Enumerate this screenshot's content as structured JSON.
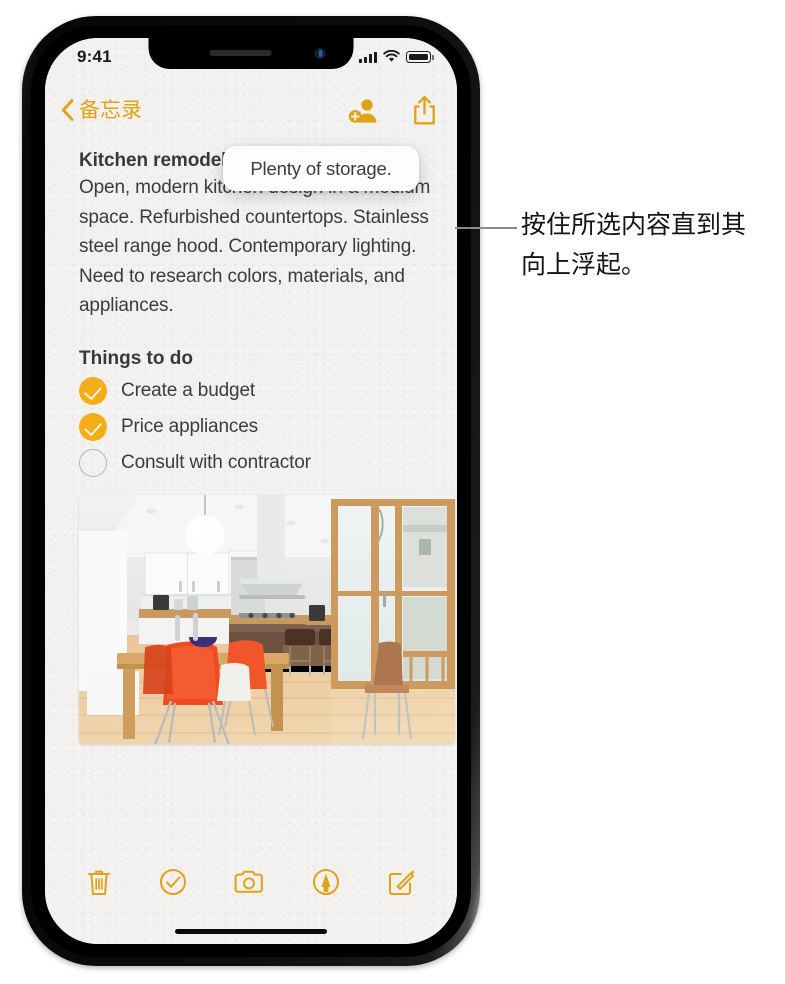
{
  "status_bar": {
    "time": "9:41",
    "cellular_icon": "signal-bars-icon",
    "wifi_icon": "wifi-icon",
    "battery_icon": "battery-full-icon"
  },
  "nav_bar": {
    "back_label": "备忘录",
    "back_icon": "chevron-left-icon",
    "collaborate_icon": "add-person-icon",
    "share_icon": "share-icon"
  },
  "note": {
    "title": "Kitchen remodel ideas",
    "paragraph": "Open, modern kitchen design in a medium space. Refurbished countertops. Stainless steel range hood. Contemporary lighting. Need to research colors, materials, and appliances.",
    "todo_heading": "Things to do",
    "todos": [
      {
        "label": "Create a budget",
        "checked": true
      },
      {
        "label": "Price appliances",
        "checked": true
      },
      {
        "label": "Consult with contractor",
        "checked": false
      }
    ],
    "photo_alt": "Modern open-plan kitchen with wooden dining table and orange chairs"
  },
  "floating_selection": {
    "text": "Plenty of storage."
  },
  "toolbar": {
    "items": [
      {
        "icon": "trash-icon",
        "name": "delete-note-button"
      },
      {
        "icon": "checklist-icon",
        "name": "checklist-button"
      },
      {
        "icon": "camera-icon",
        "name": "camera-button"
      },
      {
        "icon": "markup-pen-icon",
        "name": "markup-button"
      },
      {
        "icon": "compose-icon",
        "name": "compose-button"
      }
    ]
  },
  "callout": {
    "text": "按住所选内容直到其向上浮起。"
  },
  "colors": {
    "accent": "#e0a318",
    "check_fill": "#f5ad18",
    "text": "#3c3c3e",
    "paper": "#f3f1ef"
  }
}
